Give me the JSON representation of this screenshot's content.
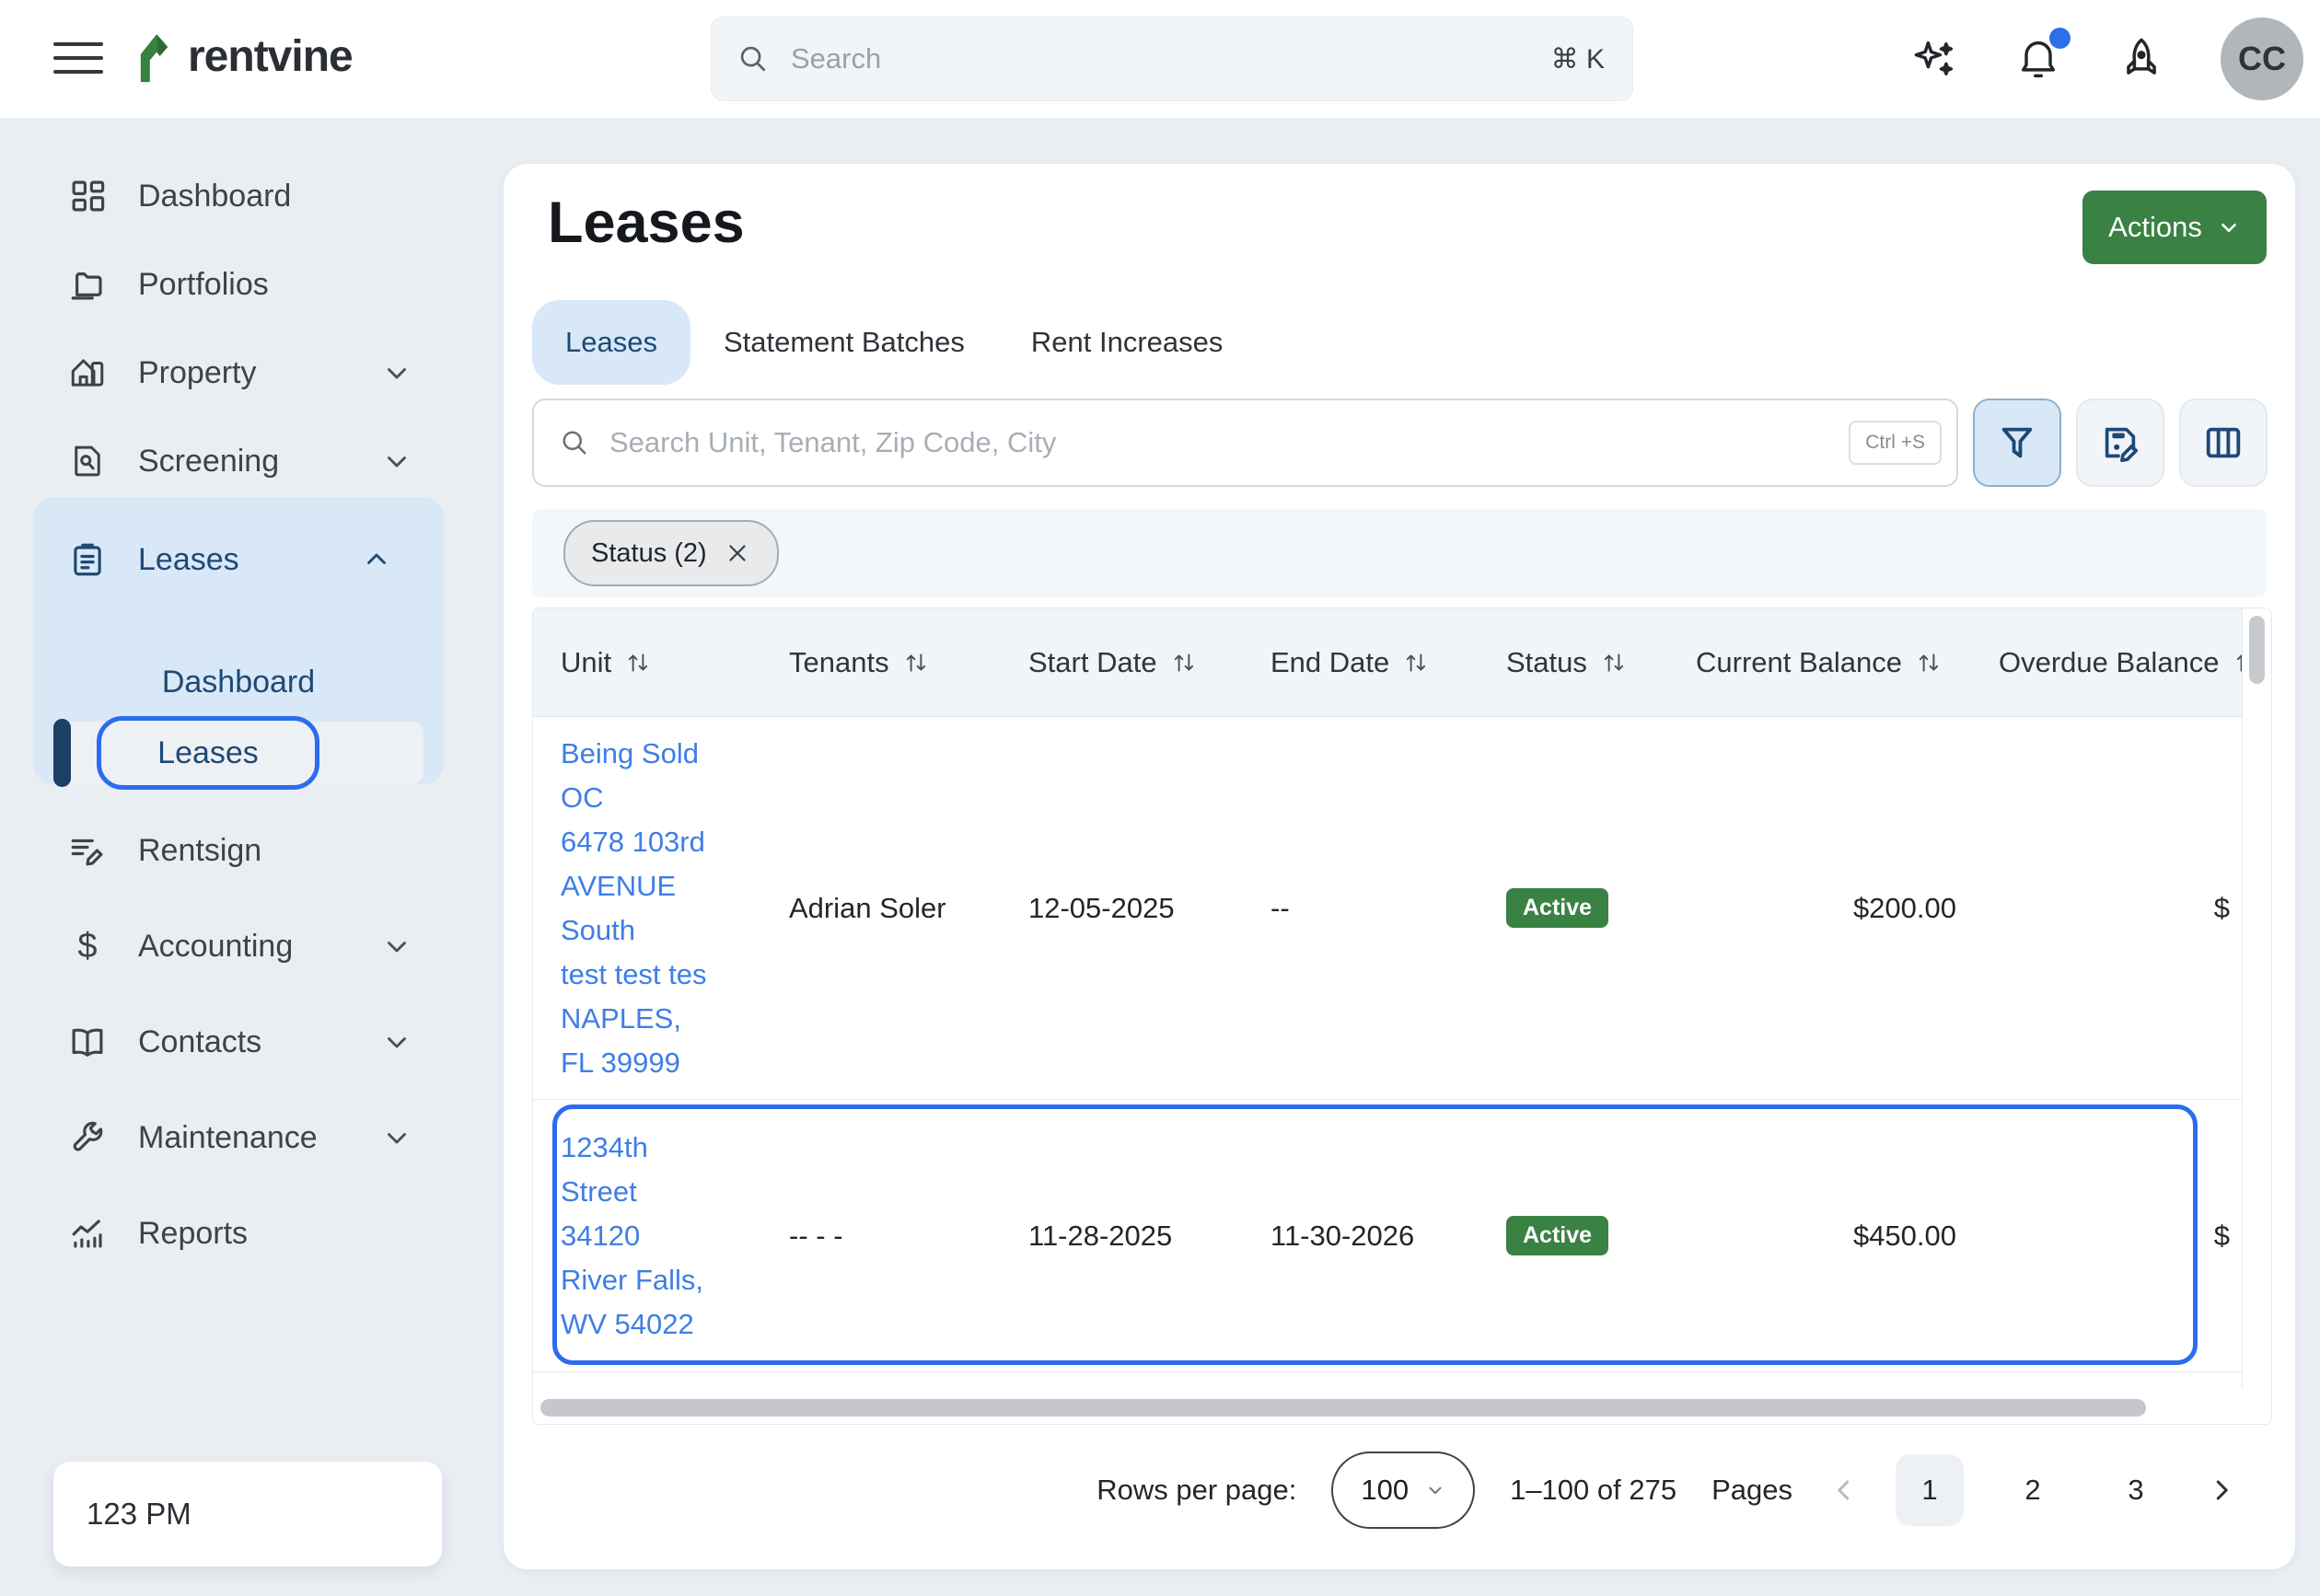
{
  "topbar": {
    "logo_text": "rentvine",
    "search_placeholder": "Search",
    "search_shortcut": "⌘ K",
    "avatar_initials": "CC"
  },
  "sidebar": {
    "items": [
      "Dashboard",
      "Portfolios",
      "Property",
      "Screening",
      "Leases",
      "Rentsign",
      "Accounting",
      "Contacts",
      "Maintenance",
      "Reports"
    ],
    "submenu": [
      "Dashboard",
      "Leases"
    ],
    "org_label": "123 PM"
  },
  "main": {
    "title": "Leases",
    "actions_button": "Actions",
    "tabs": [
      {
        "label": "Leases",
        "active": true
      },
      {
        "label": "Statement Batches",
        "active": false
      },
      {
        "label": "Rent Increases",
        "active": false
      }
    ],
    "search_placeholder": "Search Unit, Tenant, Zip Code, City",
    "search_shortcut": "Ctrl +S",
    "filter_chip": "Status (2)",
    "table": {
      "columns": [
        "Unit",
        "Tenants",
        "Start Date",
        "End Date",
        "Status",
        "Current Balance",
        "Overdue Balance"
      ],
      "rows": [
        {
          "unit_lines": [
            "Being Sold",
            "OC",
            "6478 103rd",
            "AVENUE",
            "South",
            "test test tes",
            "NAPLES,",
            "FL 39999"
          ],
          "tenants": "Adrian Soler",
          "start_date": "12-05-2025",
          "end_date": "--",
          "status": "Active",
          "current_balance": "$200.00",
          "overdue_balance": "$"
        },
        {
          "unit_lines": [
            "1234th",
            "Street",
            "34120",
            "River Falls,",
            "WV 54022"
          ],
          "tenants": "-- - -",
          "start_date": "11-28-2025",
          "end_date": "11-30-2026",
          "status": "Active",
          "current_balance": "$450.00",
          "overdue_balance": "$",
          "highlighted": true
        }
      ]
    },
    "pagination": {
      "rows_per_page_label": "Rows per page:",
      "rows_per_page": "100",
      "range": "1–100 of 275",
      "pages_label": "Pages",
      "pages": [
        "1",
        "2",
        "3"
      ],
      "current_page": "1"
    }
  },
  "colors": {
    "accent_green": "#3A8144",
    "highlight_blue": "#2B6CF0",
    "navy": "#1E4976",
    "link_blue": "#3E7EE6",
    "active_badge_green": "#3A8144"
  }
}
